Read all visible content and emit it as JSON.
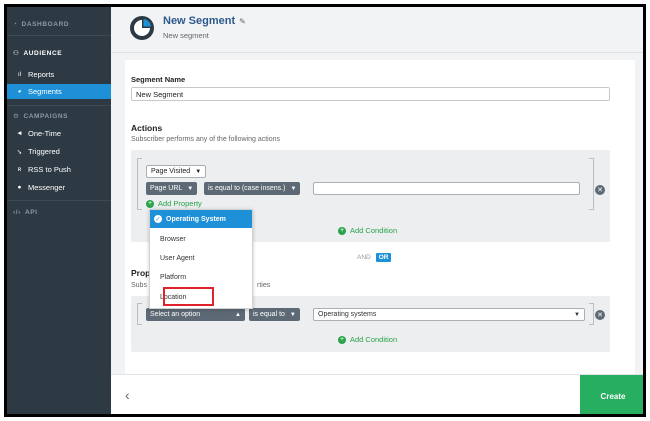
{
  "sidebar": {
    "dashboard": "DASHBOARD",
    "audience": "AUDIENCE",
    "reports": "Reports",
    "segments": "Segments",
    "campaigns": "CAMPAIGNS",
    "onetime": "One-Time",
    "triggered": "Triggered",
    "rss": "RSS to Push",
    "messenger": "Messenger",
    "api": "API"
  },
  "header": {
    "title": "New Segment",
    "subtitle": "New segment"
  },
  "form": {
    "segment_name_label": "Segment Name",
    "segment_name_value": "New Segment",
    "actions_label": "Actions",
    "actions_help": "Subscriber performs any of the following actions",
    "action_type": "Page Visited",
    "property": "Page URL",
    "operator": "is equal to (case insens.)",
    "add_property": "Add Property",
    "add_condition": "Add Condition",
    "and": "AND",
    "or": "OR",
    "properties_label_partial": "Prop",
    "properties_help_left": "Subs",
    "properties_help_right": "rties",
    "select_option": "Select an option",
    "operator2": "is equal to",
    "value2": "Operating systems",
    "add_condition2": "Add Condition"
  },
  "dropdown": {
    "items": [
      "Operating System",
      "Browser",
      "User Agent",
      "Platform",
      "Location"
    ],
    "selected": "Operating System"
  },
  "footer": {
    "create": "Create"
  },
  "colors": {
    "accent": "#1e90d8",
    "sidebar": "#2d3a44",
    "create": "#27ae60",
    "highlight": "#e0232a"
  }
}
